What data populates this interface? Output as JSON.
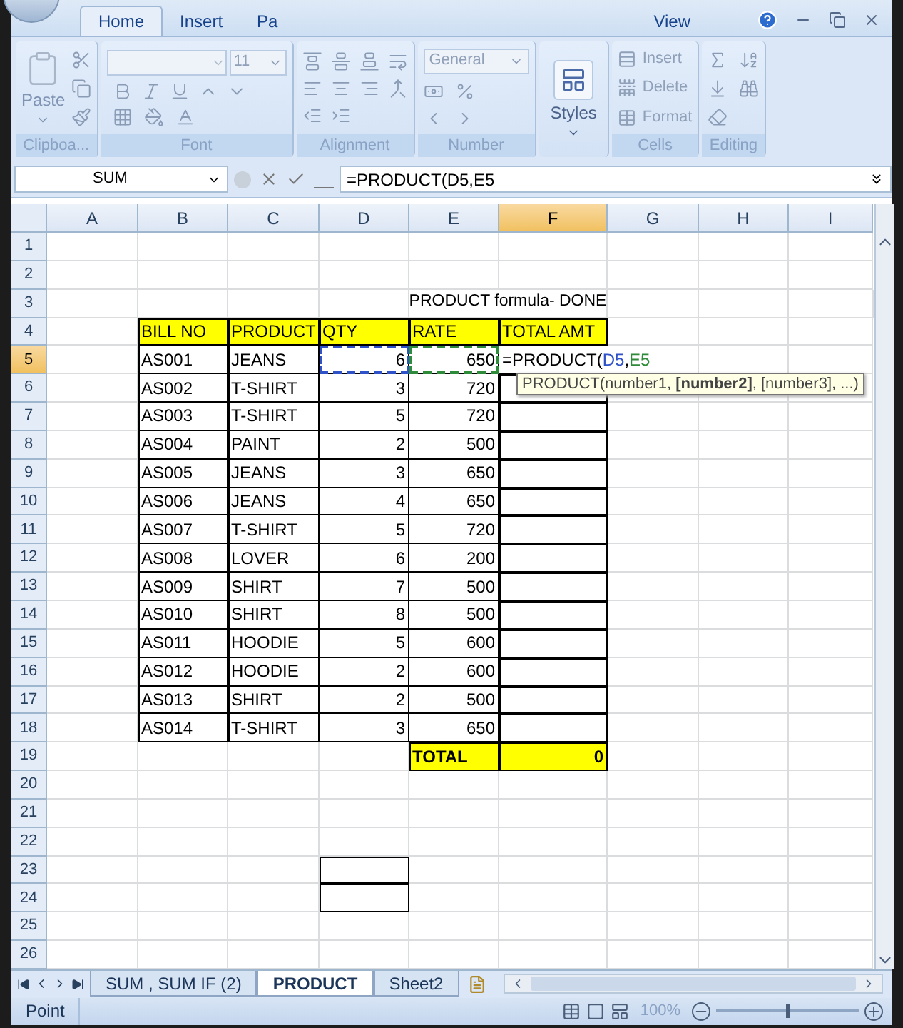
{
  "tabs": [
    {
      "label": "Home",
      "selected": true
    },
    {
      "label": "Insert",
      "selected": false
    },
    {
      "label": "Pa",
      "selected": false
    },
    {
      "label": "View",
      "selected": false
    }
  ],
  "ribbon": {
    "font_size": "11",
    "number_format": "General",
    "groups": [
      {
        "kind": "clipboard",
        "label": "Clipboa...",
        "buttons": [
          "Paste"
        ]
      },
      {
        "kind": "font",
        "label": "Font"
      },
      {
        "kind": "alignment",
        "label": "Alignment"
      },
      {
        "kind": "number",
        "label": "Number"
      },
      {
        "kind": "styles",
        "buttons": [
          "Styles"
        ]
      },
      {
        "kind": "cells",
        "label": "Cells",
        "buttons": [
          "Insert",
          "Delete",
          "Format"
        ]
      },
      {
        "kind": "editing",
        "label": "Editing"
      }
    ]
  },
  "formula_bar": {
    "name_box": "SUM",
    "formula": "=PRODUCT(D5,E5"
  },
  "columns": [
    {
      "label": "A",
      "selected": false
    },
    {
      "label": "B",
      "selected": false
    },
    {
      "label": "C",
      "selected": false
    },
    {
      "label": "D",
      "selected": false
    },
    {
      "label": "E",
      "selected": false
    },
    {
      "label": "F",
      "selected": true
    },
    {
      "label": "G",
      "selected": false
    },
    {
      "label": "H",
      "selected": false
    },
    {
      "label": "I",
      "selected": false
    }
  ],
  "rows": [
    {
      "number": "1",
      "selected": false
    },
    {
      "number": "2",
      "selected": false
    },
    {
      "number": "3",
      "selected": false,
      "cells": [
        {
          "kind": "blank"
        },
        {
          "kind": "blank"
        },
        {
          "kind": "blank"
        },
        {
          "kind": "blank"
        },
        {
          "kind": "title",
          "text": "PRODUCT formula- DONE"
        },
        {
          "kind": "blank"
        },
        {
          "kind": "blank"
        },
        {
          "kind": "blank"
        },
        {
          "kind": "blank"
        }
      ]
    },
    {
      "number": "4",
      "selected": false,
      "cells": [
        {
          "kind": "blank"
        },
        {
          "kind": "header",
          "text": "BILL NO"
        },
        {
          "kind": "header",
          "text": "PRODUCT"
        },
        {
          "kind": "header",
          "text": "QTY"
        },
        {
          "kind": "header",
          "text": "RATE"
        },
        {
          "kind": "header",
          "text": "TOTAL AMT"
        },
        {
          "kind": "blank"
        },
        {
          "kind": "blank"
        },
        {
          "kind": "blank"
        }
      ]
    },
    {
      "number": "5",
      "selected": true,
      "cells": [
        {
          "kind": "blank"
        },
        {
          "kind": "text",
          "text": "AS001"
        },
        {
          "kind": "text",
          "text": "JEANS"
        },
        {
          "kind": "number",
          "text": "6",
          "color": "#2f52c8"
        },
        {
          "kind": "number",
          "text": "650",
          "color": "#2e8b3a"
        },
        {
          "kind": "editing",
          "segments": [
            {
              "text": "=PRODUCT("
            },
            {
              "text": "D5",
              "color": "#2f52c8"
            },
            {
              "text": ","
            },
            {
              "text": "E5",
              "color": "#2e8b3a"
            }
          ],
          "tooltip": "PRODUCT(number1, **[number2]**, [number3], ...)"
        },
        {
          "kind": "blank"
        },
        {
          "kind": "blank"
        },
        {
          "kind": "blank"
        }
      ]
    },
    {
      "number": "6",
      "selected": false,
      "cells": [
        {
          "kind": "blank"
        },
        {
          "kind": "text",
          "text": "AS002"
        },
        {
          "kind": "text",
          "text": "T-SHIRT"
        },
        {
          "kind": "number",
          "text": "3"
        },
        {
          "kind": "number",
          "text": "720"
        },
        {
          "kind": "empty"
        },
        {
          "kind": "blank"
        },
        {
          "kind": "blank"
        },
        {
          "kind": "blank"
        }
      ]
    },
    {
      "number": "7",
      "selected": false,
      "cells": [
        {
          "kind": "blank"
        },
        {
          "kind": "text",
          "text": "AS003"
        },
        {
          "kind": "text",
          "text": "T-SHIRT"
        },
        {
          "kind": "number",
          "text": "5"
        },
        {
          "kind": "number",
          "text": "720"
        },
        {
          "kind": "empty"
        },
        {
          "kind": "blank"
        },
        {
          "kind": "blank"
        },
        {
          "kind": "blank"
        }
      ]
    },
    {
      "number": "8",
      "selected": false,
      "cells": [
        {
          "kind": "blank"
        },
        {
          "kind": "text",
          "text": "AS004"
        },
        {
          "kind": "text",
          "text": "PAINT"
        },
        {
          "kind": "number",
          "text": "2"
        },
        {
          "kind": "number",
          "text": "500"
        },
        {
          "kind": "empty"
        },
        {
          "kind": "blank"
        },
        {
          "kind": "blank"
        },
        {
          "kind": "blank"
        }
      ]
    },
    {
      "number": "9",
      "selected": false,
      "cells": [
        {
          "kind": "blank"
        },
        {
          "kind": "text",
          "text": "AS005"
        },
        {
          "kind": "text",
          "text": "JEANS"
        },
        {
          "kind": "number",
          "text": "3"
        },
        {
          "kind": "number",
          "text": "650"
        },
        {
          "kind": "empty"
        },
        {
          "kind": "blank"
        },
        {
          "kind": "blank"
        },
        {
          "kind": "blank"
        }
      ]
    },
    {
      "number": "10",
      "selected": false,
      "cells": [
        {
          "kind": "blank"
        },
        {
          "kind": "text",
          "text": "AS006"
        },
        {
          "kind": "text",
          "text": "JEANS"
        },
        {
          "kind": "number",
          "text": "4"
        },
        {
          "kind": "number",
          "text": "650"
        },
        {
          "kind": "empty"
        },
        {
          "kind": "blank"
        },
        {
          "kind": "blank"
        },
        {
          "kind": "blank"
        }
      ]
    },
    {
      "number": "11",
      "selected": false,
      "cells": [
        {
          "kind": "blank"
        },
        {
          "kind": "text",
          "text": "AS007"
        },
        {
          "kind": "text",
          "text": "T-SHIRT"
        },
        {
          "kind": "number",
          "text": "5"
        },
        {
          "kind": "number",
          "text": "720"
        },
        {
          "kind": "empty"
        },
        {
          "kind": "blank"
        },
        {
          "kind": "blank"
        },
        {
          "kind": "blank"
        }
      ]
    },
    {
      "number": "12",
      "selected": false,
      "cells": [
        {
          "kind": "blank"
        },
        {
          "kind": "text",
          "text": "AS008"
        },
        {
          "kind": "text",
          "text": "LOVER"
        },
        {
          "kind": "number",
          "text": "6"
        },
        {
          "kind": "number",
          "text": "200"
        },
        {
          "kind": "empty"
        },
        {
          "kind": "blank"
        },
        {
          "kind": "blank"
        },
        {
          "kind": "blank"
        }
      ]
    },
    {
      "number": "13",
      "selected": false,
      "cells": [
        {
          "kind": "blank"
        },
        {
          "kind": "text",
          "text": "AS009"
        },
        {
          "kind": "text",
          "text": "SHIRT"
        },
        {
          "kind": "number",
          "text": "7"
        },
        {
          "kind": "number",
          "text": "500"
        },
        {
          "kind": "empty"
        },
        {
          "kind": "blank"
        },
        {
          "kind": "blank"
        },
        {
          "kind": "blank"
        }
      ]
    },
    {
      "number": "14",
      "selected": false,
      "cells": [
        {
          "kind": "blank"
        },
        {
          "kind": "text",
          "text": "AS010"
        },
        {
          "kind": "text",
          "text": "SHIRT"
        },
        {
          "kind": "number",
          "text": "8"
        },
        {
          "kind": "number",
          "text": "500"
        },
        {
          "kind": "empty"
        },
        {
          "kind": "blank"
        },
        {
          "kind": "blank"
        },
        {
          "kind": "blank"
        }
      ]
    },
    {
      "number": "15",
      "selected": false,
      "cells": [
        {
          "kind": "blank"
        },
        {
          "kind": "text",
          "text": "AS011"
        },
        {
          "kind": "text",
          "text": "HOODIE"
        },
        {
          "kind": "number",
          "text": "5"
        },
        {
          "kind": "number",
          "text": "600"
        },
        {
          "kind": "empty"
        },
        {
          "kind": "blank"
        },
        {
          "kind": "blank"
        },
        {
          "kind": "blank"
        }
      ]
    },
    {
      "number": "16",
      "selected": false,
      "cells": [
        {
          "kind": "blank"
        },
        {
          "kind": "text",
          "text": "AS012"
        },
        {
          "kind": "text",
          "text": "HOODIE"
        },
        {
          "kind": "number",
          "text": "2"
        },
        {
          "kind": "number",
          "text": "600"
        },
        {
          "kind": "empty"
        },
        {
          "kind": "blank"
        },
        {
          "kind": "blank"
        },
        {
          "kind": "blank"
        }
      ]
    },
    {
      "number": "17",
      "selected": false,
      "cells": [
        {
          "kind": "blank"
        },
        {
          "kind": "text",
          "text": "AS013"
        },
        {
          "kind": "text",
          "text": "SHIRT"
        },
        {
          "kind": "number",
          "text": "2"
        },
        {
          "kind": "number",
          "text": "500"
        },
        {
          "kind": "empty"
        },
        {
          "kind": "blank"
        },
        {
          "kind": "blank"
        },
        {
          "kind": "blank"
        }
      ]
    },
    {
      "number": "18",
      "selected": false,
      "cells": [
        {
          "kind": "blank"
        },
        {
          "kind": "text",
          "text": "AS014"
        },
        {
          "kind": "text",
          "text": "T-SHIRT"
        },
        {
          "kind": "number",
          "text": "3"
        },
        {
          "kind": "number",
          "text": "650"
        },
        {
          "kind": "empty"
        },
        {
          "kind": "blank"
        },
        {
          "kind": "blank"
        },
        {
          "kind": "blank"
        }
      ]
    },
    {
      "number": "19",
      "selected": false,
      "cells": [
        {
          "kind": "blank"
        },
        {
          "kind": "blank"
        },
        {
          "kind": "blank"
        },
        {
          "kind": "blank"
        },
        {
          "kind": "total",
          "text": "TOTAL"
        },
        {
          "kind": "total_value",
          "text": "0"
        },
        {
          "kind": "blank"
        },
        {
          "kind": "blank"
        },
        {
          "kind": "blank"
        }
      ]
    },
    {
      "number": "20",
      "selected": false
    },
    {
      "number": "21",
      "selected": false
    },
    {
      "number": "22",
      "selected": false
    },
    {
      "number": "23",
      "selected": false,
      "cells": [
        {
          "kind": "blank"
        },
        {
          "kind": "blank"
        },
        {
          "kind": "blank"
        },
        {
          "kind": "empty"
        },
        {
          "kind": "blank"
        },
        {
          "kind": "blank"
        },
        {
          "kind": "blank"
        },
        {
          "kind": "blank"
        },
        {
          "kind": "blank"
        }
      ]
    },
    {
      "number": "24",
      "selected": false,
      "cells": [
        {
          "kind": "blank"
        },
        {
          "kind": "blank"
        },
        {
          "kind": "blank"
        },
        {
          "kind": "empty"
        },
        {
          "kind": "blank"
        },
        {
          "kind": "blank"
        },
        {
          "kind": "blank"
        },
        {
          "kind": "blank"
        },
        {
          "kind": "blank"
        }
      ]
    },
    {
      "number": "25",
      "selected": false
    },
    {
      "number": "26",
      "selected": false
    }
  ],
  "sheet_tabs": [
    {
      "label": "SUM , SUM IF (2)",
      "selected": false
    },
    {
      "label": "PRODUCT",
      "selected": true
    },
    {
      "label": "Sheet2",
      "selected": false
    }
  ],
  "status_bar": {
    "mode": "Point",
    "zoom": "100%",
    "zoom_slider": {
      "level": 0.5
    }
  }
}
